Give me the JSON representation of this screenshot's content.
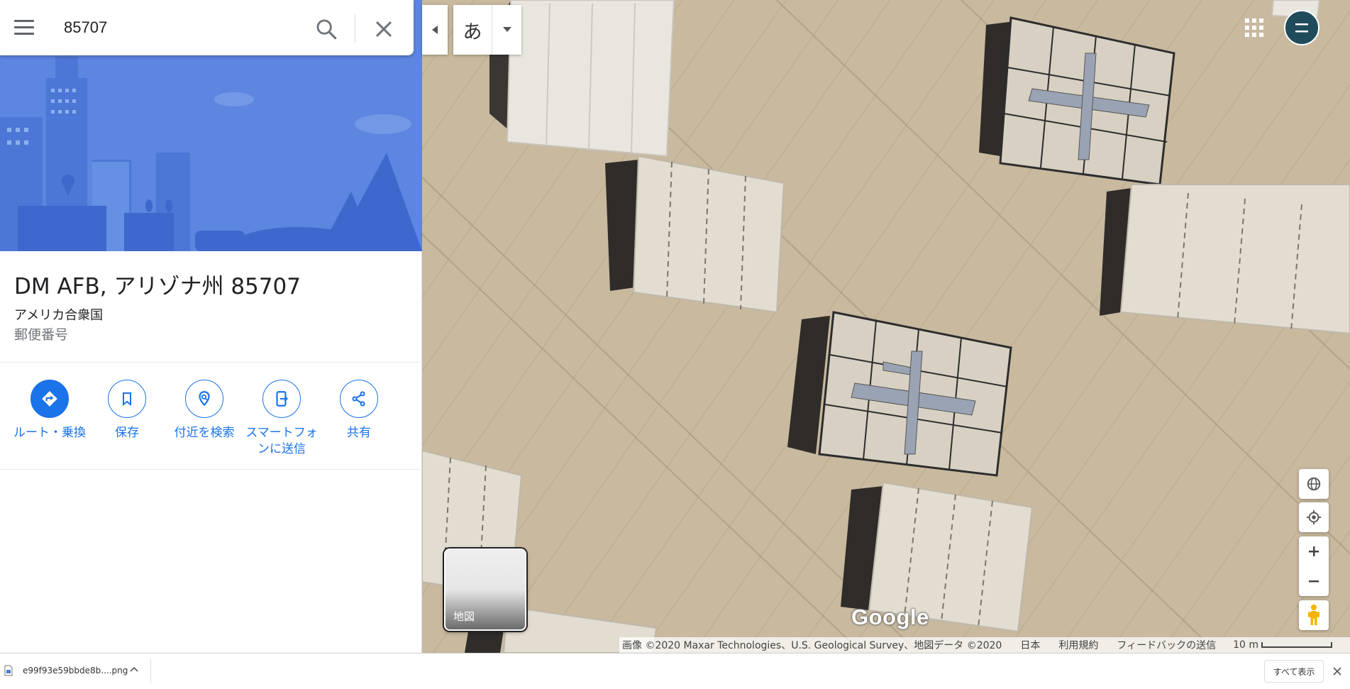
{
  "search": {
    "query": "85707"
  },
  "place": {
    "title": "DM AFB, アリゾナ州 85707",
    "country": "アメリカ合衆国",
    "type": "郵便番号"
  },
  "actions": [
    {
      "label": "ルート・乗換",
      "icon": "directions-icon"
    },
    {
      "label": "保存",
      "icon": "bookmark-icon"
    },
    {
      "label": "付近を検索",
      "icon": "nearby-icon"
    },
    {
      "label": "スマートフォンに送信",
      "icon": "send-to-phone-icon"
    },
    {
      "label": "共有",
      "icon": "share-icon"
    }
  ],
  "map": {
    "ime_char": "あ",
    "layer_toggle_label": "地図",
    "logo": "Google",
    "attribution": "画像 ©2020 Maxar Technologies、U.S. Geological Survey、地図データ ©2020",
    "links": [
      "日本",
      "利用規約",
      "フィードバックの送信"
    ],
    "scale": "10 m"
  },
  "download_bar": {
    "filename": "e99f93e59bbde8b....png",
    "show_all": "すべて表示"
  },
  "colors": {
    "accent": "#1a73e8",
    "hero": "#5c86e0",
    "avatar": "#1f4b5a"
  }
}
